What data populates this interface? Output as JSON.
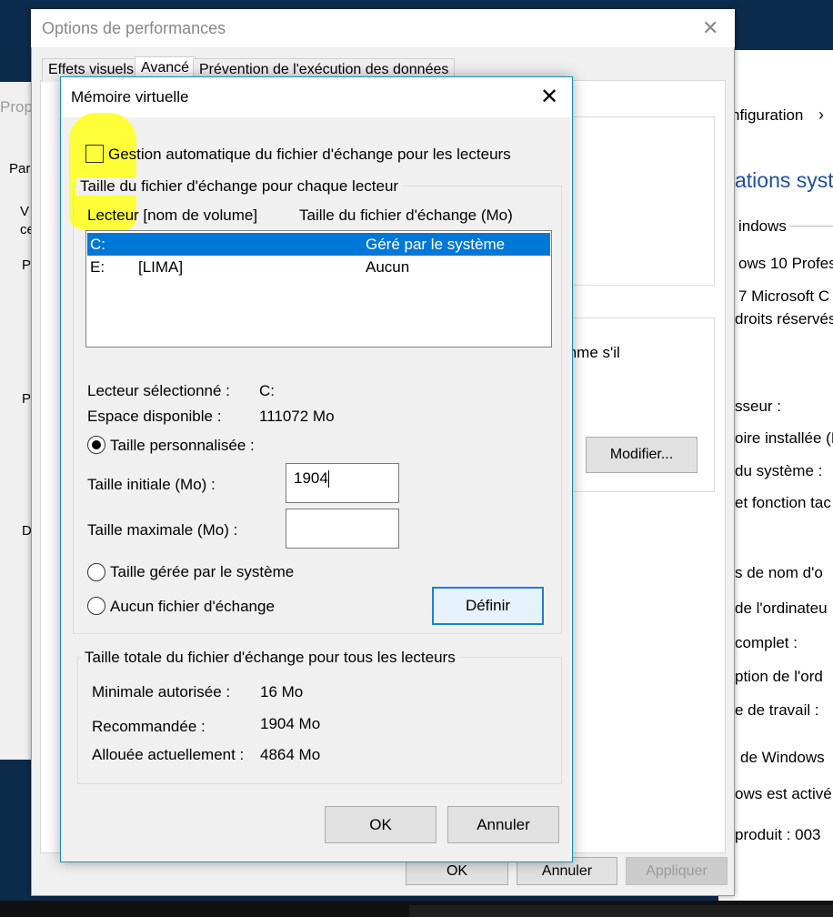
{
  "prop_window": {
    "title": "Prop",
    "tab": "Par",
    "fragments": [
      "V",
      "ce",
      "P",
      "P",
      "D"
    ]
  },
  "sys_window": {
    "breadcrumb": "nfiguration",
    "heading": "ations syste",
    "lines": [
      "indows",
      "ows 10 Profess",
      "7 Microsoft C",
      "droits réservés",
      "sseur :",
      "oire installée (R",
      "du système :",
      "et fonction tac",
      "s de nom d'o",
      "de l'ordinateu",
      "complet :",
      "ption de l'ord",
      "e de travail :",
      "de Windows",
      "ows est activé.",
      "produit :  003"
    ]
  },
  "perf_window": {
    "title": "Options de performances",
    "tabs": [
      "Effets visuels",
      "Avancé",
      "Prévention de l'exécution des données"
    ],
    "partial_text": "mme s'il",
    "modify_button": "Modifier...",
    "ok_button": "OK",
    "cancel_button": "Annuler",
    "apply_button": "Appliquer"
  },
  "dialog": {
    "title": "Mémoire virtuelle",
    "auto_manage_label": "Gestion automatique du fichier d'échange pour les lecteurs",
    "per_drive_group_title": "Taille du fichier d'échange pour chaque lecteur",
    "columns": [
      "Lecteur [nom de volume]",
      "Taille du fichier d'échange (Mo)"
    ],
    "drives": [
      {
        "drive": "C:",
        "volume": "",
        "size": "Géré par le système",
        "selected": true
      },
      {
        "drive": "E:",
        "volume": "[LIMA]",
        "size": "Aucun",
        "selected": false
      }
    ],
    "selected_drive_label": "Lecteur sélectionné :",
    "selected_drive_value": "C:",
    "free_space_label": "Espace disponible :",
    "free_space_value": "111072 Mo",
    "custom_size_label": "Taille personnalisée :",
    "initial_size_label": "Taille initiale (Mo) :",
    "initial_size_value": "1904",
    "max_size_label": "Taille maximale (Mo) :",
    "max_size_value": "",
    "system_managed_label": "Taille gérée par le système",
    "no_paging_label": "Aucun fichier d'échange",
    "set_button": "Définir",
    "total_group_title": "Taille totale du fichier d'échange pour tous les lecteurs",
    "min_allowed_label": "Minimale autorisée :",
    "min_allowed_value": "16 Mo",
    "recommended_label": "Recommandée :",
    "recommended_value": "1904 Mo",
    "allocated_label": "Allouée actuellement :",
    "allocated_value": "4864 Mo",
    "ok_button": "OK",
    "cancel_button": "Annuler"
  }
}
